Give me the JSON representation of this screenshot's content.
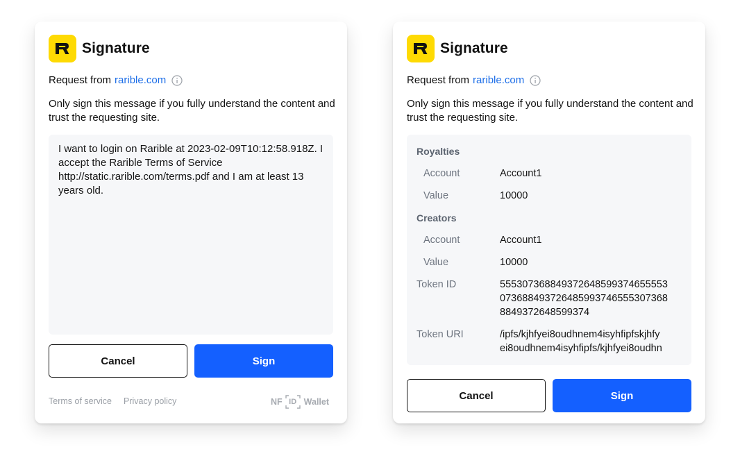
{
  "colors": {
    "brand_yellow": "#FEDA03",
    "link": "#1E6FE8",
    "primary": "#1460FF",
    "panel_bg": "#F6F7F9"
  },
  "left": {
    "title": "Signature",
    "request_prefix": "Request from",
    "request_site": "rarible.com",
    "warning": "Only sign this message if you fully understand the content and trust the requesting site.",
    "message": "I want to login on Rarible at 2023-02-09T10:12:58.918Z. I accept the Rarible Terms of Service http://static.rarible.com/terms.pdf and I am at least 13 years old.",
    "cancel_label": "Cancel",
    "sign_label": "Sign",
    "footer": {
      "terms": "Terms of service",
      "privacy": "Privacy policy",
      "brand_nf": "NF",
      "brand_id": "ID",
      "brand_wallet": "Wallet"
    }
  },
  "right": {
    "title": "Signature",
    "request_prefix": "Request from",
    "request_site": "rarible.com",
    "warning": "Only sign this message if you fully understand the content and trust the requesting site.",
    "royalties": {
      "title": "Royalties",
      "account_label": "Account",
      "account_value": "Account1",
      "value_label": "Value",
      "value_value": "10000"
    },
    "creators": {
      "title": "Creators",
      "account_label": "Account",
      "account_value": "Account1",
      "value_label": "Value",
      "value_value": "10000"
    },
    "token_id_label": "Token ID",
    "token_id_lines": [
      "555307368849372648599374655553",
      "073688493726485993746555307368",
      "8849372648599374"
    ],
    "token_uri_label": "Token URI",
    "token_uri_lines": [
      "/ipfs/kjhfyei8oudhnem4isyhfipfskjhfy",
      "ei8oudhnem4isyhfipfs/kjhfyei8oudhn"
    ],
    "cancel_label": "Cancel",
    "sign_label": "Sign"
  }
}
